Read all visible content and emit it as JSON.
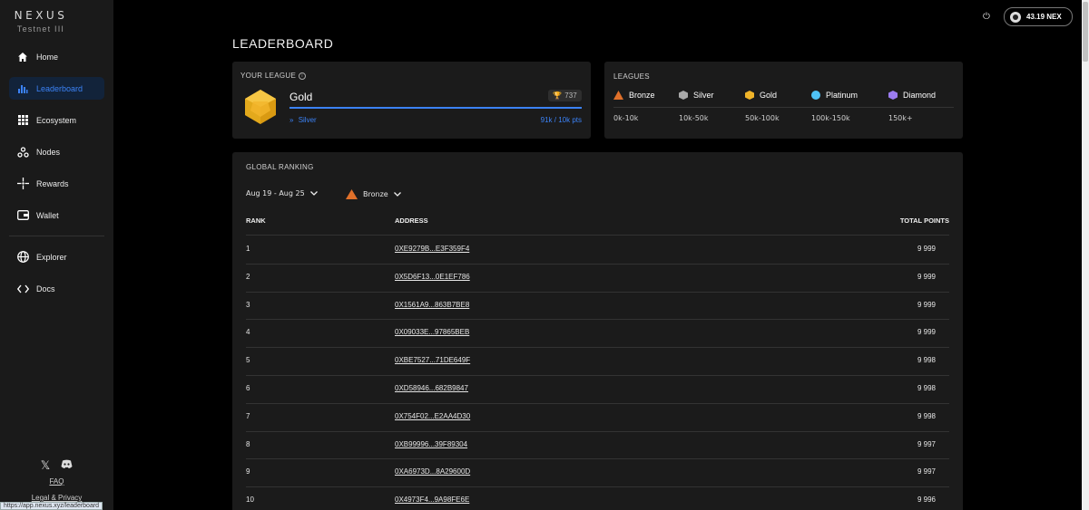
{
  "app": {
    "brand": "NEXUS",
    "network": "Testnet III"
  },
  "sidebar": {
    "items": [
      {
        "label": "Home",
        "icon": "home-icon"
      },
      {
        "label": "Leaderboard",
        "icon": "bar-chart-icon"
      },
      {
        "label": "Ecosystem",
        "icon": "grid-icon"
      },
      {
        "label": "Nodes",
        "icon": "nodes-icon"
      },
      {
        "label": "Rewards",
        "icon": "sparkle-icon"
      },
      {
        "label": "Wallet",
        "icon": "wallet-icon"
      },
      {
        "label": "Explorer",
        "icon": "globe-icon"
      },
      {
        "label": "Docs",
        "icon": "code-icon"
      }
    ],
    "footer": {
      "faq": "FAQ",
      "legal": "Legal & Privacy"
    },
    "status_url": "https://app.nexus.xyz/leaderboard"
  },
  "topbar": {
    "balance": "43.19 NEX"
  },
  "page": {
    "title": "LEADERBOARD"
  },
  "your_league": {
    "label": "YOUR LEAGUE",
    "name": "Gold",
    "trophies": "737",
    "next_league": "Silver",
    "points": "91k / 10k pts",
    "progress": 1.0
  },
  "leagues": {
    "label": "LEAGUES",
    "items": [
      {
        "name": "Bronze",
        "range": "0k-10k",
        "color": "#e0702a"
      },
      {
        "name": "Silver",
        "range": "10k-50k",
        "color": "#a9a9a9"
      },
      {
        "name": "Gold",
        "range": "50k-100k",
        "color": "#f0b429"
      },
      {
        "name": "Platinum",
        "range": "100k-150k",
        "color": "#4fc3f7"
      },
      {
        "name": "Diamond",
        "range": "150k+",
        "color": "#9b7cf0"
      }
    ]
  },
  "ranking": {
    "label": "GLOBAL RANKING",
    "date_range": "Aug 19 - Aug 25",
    "league_filter": "Bronze",
    "headers": {
      "rank": "RANK",
      "address": "ADDRESS",
      "points": "TOTAL POINTS"
    },
    "rows": [
      {
        "rank": "1",
        "address": "0XE9279B...E3F359F4",
        "points": "9 999"
      },
      {
        "rank": "2",
        "address": "0X5D6F13...0E1EF786",
        "points": "9 999"
      },
      {
        "rank": "3",
        "address": "0X1561A9...863B7BE8",
        "points": "9 999"
      },
      {
        "rank": "4",
        "address": "0X09033E...97865BEB",
        "points": "9 999"
      },
      {
        "rank": "5",
        "address": "0XBE7527...71DE649F",
        "points": "9 998"
      },
      {
        "rank": "6",
        "address": "0XD58946...682B9847",
        "points": "9 998"
      },
      {
        "rank": "7",
        "address": "0X754F02...E2AA4D30",
        "points": "9 998"
      },
      {
        "rank": "8",
        "address": "0XB99996...39F89304",
        "points": "9 997"
      },
      {
        "rank": "9",
        "address": "0XA6973D...8A29600D",
        "points": "9 997"
      },
      {
        "rank": "10",
        "address": "0X4973F4...9A98FE6E",
        "points": "9 996"
      }
    ]
  }
}
